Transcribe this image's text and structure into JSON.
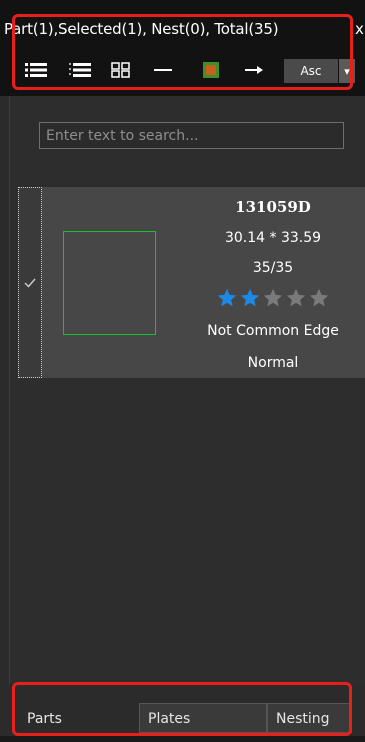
{
  "header": {
    "summary": "Part(1),Selected(1), Nest(0), Total(35)",
    "close_glyph": "x"
  },
  "toolbar": {
    "icons": [
      "list-large-icon",
      "list-small-icon",
      "grid-icon",
      "collapse-icon",
      "color-icon",
      "sort-arrow-icon"
    ],
    "sort_label": "Asc",
    "dropdown_glyph": "▾"
  },
  "search": {
    "placeholder": "Enter text to search..."
  },
  "part": {
    "checked": true,
    "name": "131059D",
    "dimensions": "30.14 * 33.59",
    "quantity": "35/35",
    "rating": 2,
    "rating_max": 5,
    "edge_mode": "Not Common Edge",
    "status": "Normal"
  },
  "tabs": [
    {
      "label": "Parts",
      "active": true
    },
    {
      "label": "Plates",
      "active": false
    },
    {
      "label": "Nesting",
      "active": false
    }
  ],
  "colors": {
    "star_on": "#1e88e5",
    "star_off": "#7a7a7a",
    "highlight": "#e8201c",
    "thumb_outline": "#16c12d"
  }
}
